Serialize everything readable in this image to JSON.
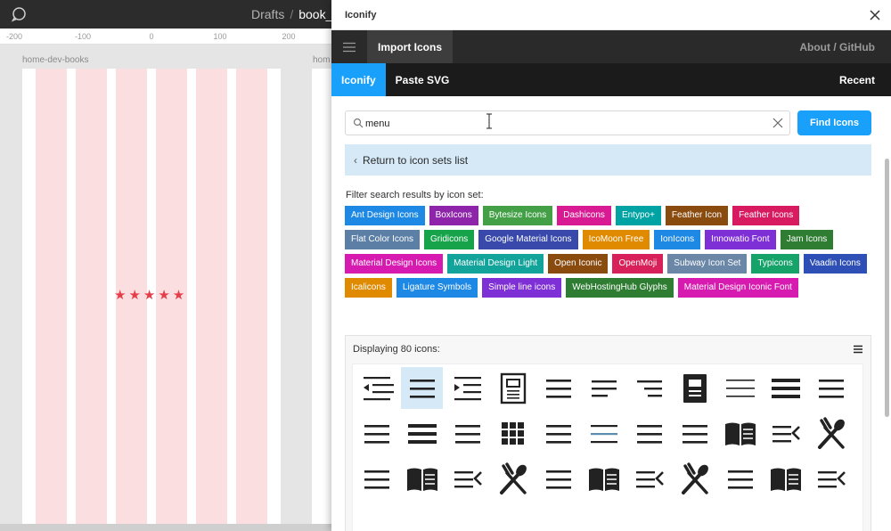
{
  "figma": {
    "breadcrumb_project": "Drafts",
    "breadcrumb_sep": "/",
    "breadcrumb_file": "book_",
    "ruler_labels": [
      "-200",
      "-100",
      "0",
      "100",
      "200"
    ],
    "frame_label_1": "home-dev-books",
    "frame_label_2": "hom",
    "stars": "★★★★★",
    "star_color": "#e53e4b",
    "column_color": "#fbdfe0"
  },
  "plugin": {
    "title": "Iconify",
    "nav": {
      "import_icons": "Import Icons",
      "about": "About / GitHub"
    },
    "subnav": {
      "iconify": "Iconify",
      "paste_svg": "Paste SVG",
      "recent": "Recent"
    },
    "search": {
      "value": "menu",
      "placeholder": "",
      "button": "Find Icons"
    },
    "return_label": "Return to icon sets list",
    "filter_label": "Filter search results by icon set:",
    "accent": "#18a0fb",
    "tags": [
      {
        "label": "Ant Design Icons",
        "color": "#1e88e5"
      },
      {
        "label": "BoxIcons",
        "color": "#8e24aa"
      },
      {
        "label": "Bytesize Icons",
        "color": "#43a047"
      },
      {
        "label": "Dashicons",
        "color": "#d81b92"
      },
      {
        "label": "Entypo+",
        "color": "#00a3a3"
      },
      {
        "label": "Feather Icon",
        "color": "#8a4b0f"
      },
      {
        "label": "Feather Icons",
        "color": "#d81b60"
      },
      {
        "label": "Flat Color Icons",
        "color": "#5c7fa6"
      },
      {
        "label": "Gridicons",
        "color": "#16a34a"
      },
      {
        "label": "Google Material Icons",
        "color": "#3949ab"
      },
      {
        "label": "IcoMoon Free",
        "color": "#e08a00"
      },
      {
        "label": "IonIcons",
        "color": "#1e88e5"
      },
      {
        "label": "Innowatio Font",
        "color": "#7e2fd6"
      },
      {
        "label": "Jam Icons",
        "color": "#2e7d32"
      },
      {
        "label": "Material Design Icons",
        "color": "#d81bb0"
      },
      {
        "label": "Material Design Light",
        "color": "#12a39a"
      },
      {
        "label": "Open Iconic",
        "color": "#8a4b0f"
      },
      {
        "label": "OpenMoji",
        "color": "#d8205a"
      },
      {
        "label": "Subway Icon Set",
        "color": "#6b87a8"
      },
      {
        "label": "Typicons",
        "color": "#16a36a"
      },
      {
        "label": "Vaadin Icons",
        "color": "#2e4fb5"
      },
      {
        "label": "Icalicons",
        "color": "#e08a00"
      },
      {
        "label": "Ligature Symbols",
        "color": "#1e88e5"
      },
      {
        "label": "Simple line icons",
        "color": "#7e2fd6"
      },
      {
        "label": "WebHostingHub Glyphs",
        "color": "#2e7d32"
      },
      {
        "label": "Material Design Iconic Font",
        "color": "#d81bb0"
      }
    ],
    "results_label": "Displaying 80 icons:",
    "icons": [
      "indent-decrease",
      "menu-lines",
      "indent-increase",
      "notebook",
      "menu-lines",
      "align-left",
      "align-right",
      "book-filled",
      "menu-thin",
      "menu-bold",
      "menu-lines",
      "menu-lines",
      "menu-bold",
      "menu-lines",
      "grid",
      "menu-lines",
      "menu-colored",
      "menu-lines",
      "menu-lines",
      "book-open",
      "menu-close",
      "fork-spoon",
      "menu-lines",
      "book-open",
      "menu-close",
      "fork-spoon",
      "menu-lines",
      "book-open",
      "menu-close",
      "fork-spoon",
      "menu-lines",
      "book-open",
      "menu-close"
    ]
  }
}
